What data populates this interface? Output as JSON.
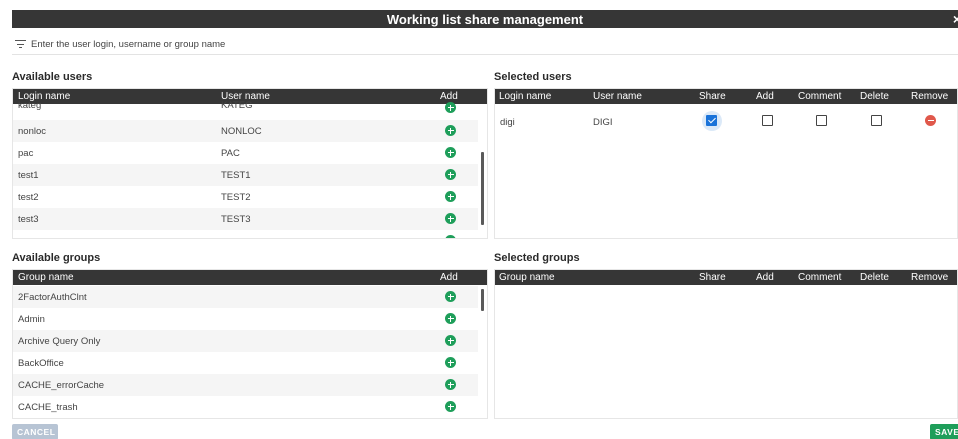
{
  "dialog": {
    "title": "Working list share management",
    "close_glyph": "×"
  },
  "filter": {
    "placeholder": "Enter the user login, username or group name",
    "value": ""
  },
  "available_users": {
    "title": "Available users",
    "columns": {
      "login": "Login name",
      "user": "User name",
      "add": "Add"
    },
    "rows": [
      {
        "login": "kateg",
        "user": "KATEG"
      },
      {
        "login": "nonloc",
        "user": "NONLOC"
      },
      {
        "login": "pac",
        "user": "PAC"
      },
      {
        "login": "test1",
        "user": "TEST1"
      },
      {
        "login": "test2",
        "user": "TEST2"
      },
      {
        "login": "test3",
        "user": "TEST3"
      }
    ]
  },
  "selected_users": {
    "title": "Selected users",
    "columns": {
      "login": "Login name",
      "user": "User name",
      "share": "Share",
      "add": "Add",
      "comment": "Comment",
      "delete": "Delete",
      "remove": "Remove"
    },
    "rows": [
      {
        "login": "digi",
        "user": "DIGI",
        "share": true,
        "add": false,
        "comment": false,
        "delete": false
      }
    ]
  },
  "available_groups": {
    "title": "Available groups",
    "columns": {
      "group": "Group name",
      "add": "Add"
    },
    "rows": [
      {
        "group": "2FactorAuthClnt"
      },
      {
        "group": "Admin"
      },
      {
        "group": "Archive Query Only"
      },
      {
        "group": "BackOffice"
      },
      {
        "group": "CACHE_errorCache"
      },
      {
        "group": "CACHE_trash"
      }
    ]
  },
  "selected_groups": {
    "title": "Selected groups",
    "columns": {
      "group": "Group name",
      "share": "Share",
      "add": "Add",
      "comment": "Comment",
      "delete": "Delete",
      "remove": "Remove"
    },
    "rows": []
  },
  "actions": {
    "cancel": "CANCEL",
    "save": "SAVE"
  },
  "colors": {
    "header": "#363636",
    "add": "#1e9e5a",
    "remove": "#e0584b",
    "checked": "#1a73d9",
    "cancel": "#b7c4d4",
    "save": "#1e9e5a"
  }
}
